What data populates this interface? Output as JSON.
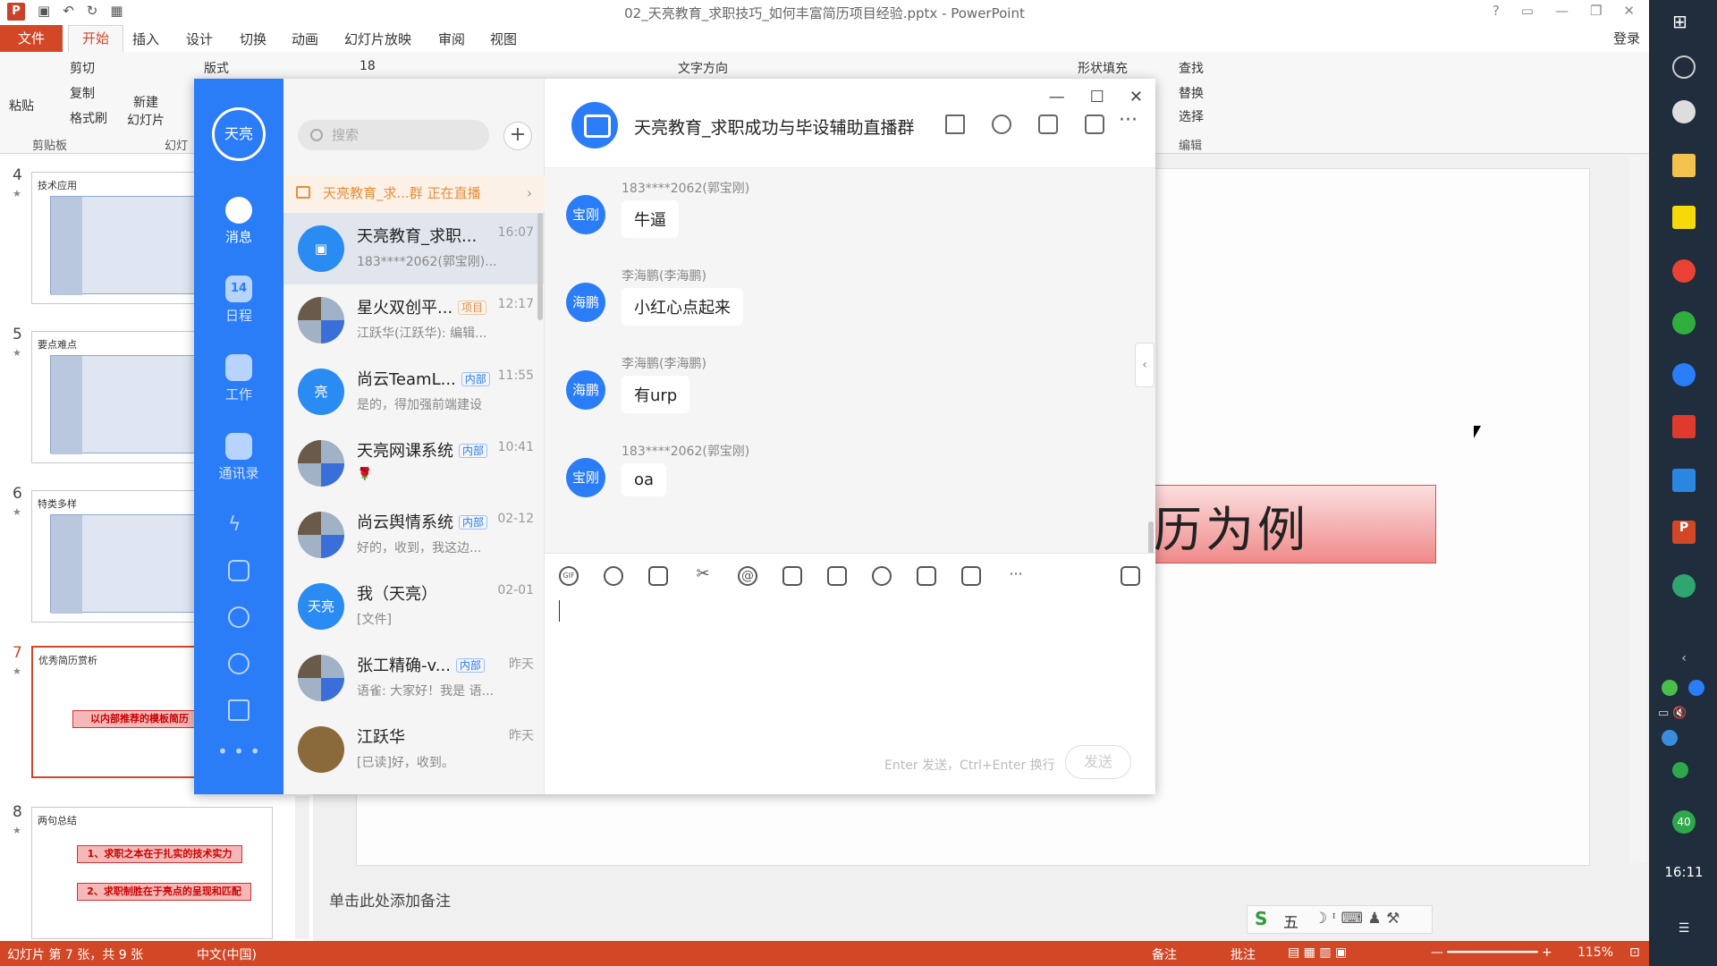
{
  "powerpoint": {
    "title": "02_天亮教育_求职技巧_如何丰富简历项目经验.pptx - PowerPoint",
    "tabs": [
      "文件",
      "开始",
      "插入",
      "设计",
      "切换",
      "动画",
      "幻灯片放映",
      "审阅",
      "视图"
    ],
    "login": "登录",
    "ribbon": {
      "paste": "粘贴",
      "cut": "剪切",
      "copy": "复制",
      "format_painter": "格式刷",
      "clipboard_group": "剪贴板",
      "new_slide": "新建\n幻灯片",
      "layout": "版式",
      "slides_group": "幻灯",
      "text_direction": "文字方向",
      "shape_fill": "形状填充",
      "find": "查找",
      "replace": "替换",
      "select": "选择",
      "edit_group": "编辑",
      "font_size": "18"
    },
    "slides": [
      {
        "num": "4",
        "title": "技术应用"
      },
      {
        "num": "5",
        "title": "要点难点"
      },
      {
        "num": "6",
        "title": "特类多样"
      },
      {
        "num": "7",
        "title": "优秀简历赏析",
        "box": "以内部推荐的模板简历"
      },
      {
        "num": "8",
        "title": "两句总结",
        "box1": "1、求职之本在于扎实的技术实力",
        "box2": "2、求职制胜在于亮点的呈现和匹配"
      }
    ],
    "slide_visible_text": "历为例",
    "notes_placeholder": "单击此处添加备注",
    "status": {
      "slide_count": "幻灯片 第 7 张，共 9 张",
      "language": "中文(中国)",
      "notes": "备注",
      "comments": "批注",
      "zoom": "115%"
    },
    "ime_label": "五"
  },
  "taskbar": {
    "clock": "16:11",
    "badge": "40"
  },
  "chat": {
    "user_avatar": "天亮",
    "nav": [
      {
        "label": "消息",
        "icon": "message-icon"
      },
      {
        "label": "日程",
        "icon": "calendar-icon",
        "badge": "14"
      },
      {
        "label": "工作",
        "icon": "apps-icon"
      },
      {
        "label": "通讯录",
        "icon": "contacts-icon"
      }
    ],
    "search_placeholder": "搜索",
    "live_banner": "天亮教育_求...群 正在直播",
    "conversations": [
      {
        "name": "天亮教育_求职...",
        "time": "16:07",
        "preview": "183****2062(郭宝刚)...",
        "tag": ""
      },
      {
        "name": "星火双创平...",
        "time": "12:17",
        "preview": "江跃华(江跃华): 编辑...",
        "tag": "项目"
      },
      {
        "name": "尚云TeamL...",
        "time": "11:55",
        "preview": "是的，得加强前端建设",
        "tag": "内部"
      },
      {
        "name": "天亮网课系统",
        "time": "10:41",
        "preview": "🌹",
        "tag": "内部"
      },
      {
        "name": "尚云舆情系统",
        "time": "02-12",
        "preview": "好的，收到，我这边...",
        "tag": "内部"
      },
      {
        "name": "我（天亮）",
        "time": "02-01",
        "preview": "[文件]",
        "tag": "",
        "avatar": "天亮"
      },
      {
        "name": "张工精确-v...",
        "time": "昨天",
        "preview": "语雀: 大家好！我是 语...",
        "tag": "内部"
      },
      {
        "name": "江跃华",
        "time": "昨天",
        "preview": "[已读]好，收到。",
        "tag": ""
      }
    ],
    "group_name": "天亮教育_求职成功与毕设辅助直播群",
    "messages": [
      {
        "avatar": "宝刚",
        "sender": "183****2062(郭宝刚)",
        "text": "牛逼"
      },
      {
        "avatar": "海鹏",
        "sender": "李海鹏(李海鹏)",
        "text": "小红心点起来"
      },
      {
        "avatar": "海鹏",
        "sender": "李海鹏(李海鹏)",
        "text": "有urp"
      },
      {
        "avatar": "宝刚",
        "sender": "183****2062(郭宝刚)",
        "text": "oa"
      }
    ],
    "composer": {
      "gif": "GIF",
      "hint": "Enter 发送，Ctrl+Enter 换行",
      "send": "发送"
    }
  }
}
